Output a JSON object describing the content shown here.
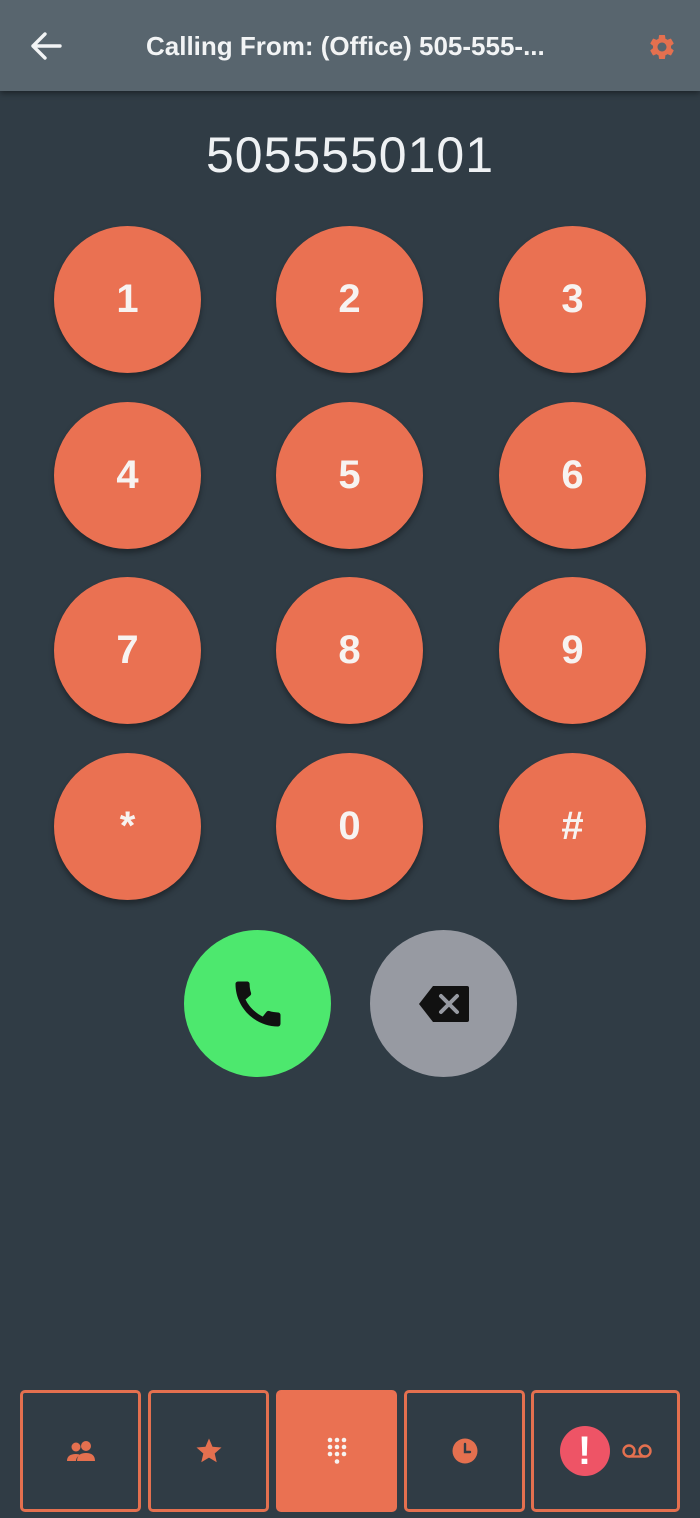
{
  "header": {
    "title": "Calling From: (Office) 505-555-...",
    "back_icon": "arrow-left-icon",
    "settings_icon": "gear-icon"
  },
  "dialed_number": "5055550101",
  "keypad": {
    "keys": [
      "1",
      "2",
      "3",
      "4",
      "5",
      "6",
      "7",
      "8",
      "9",
      "*",
      "0",
      "#"
    ]
  },
  "actions": {
    "call_icon": "phone-icon",
    "backspace_icon": "backspace-icon"
  },
  "tabs": [
    {
      "name": "contacts",
      "icon": "contacts-icon"
    },
    {
      "name": "favorites",
      "icon": "star-icon"
    },
    {
      "name": "keypad",
      "icon": "dialpad-icon",
      "active": true
    },
    {
      "name": "recents",
      "icon": "clock-icon"
    },
    {
      "name": "voicemail",
      "icon": "voicemail-icon",
      "badge": "!"
    }
  ],
  "colors": {
    "background": "#303c45",
    "header": "#58656e",
    "accent": "#ea7152",
    "call": "#4de86e",
    "backspace": "#979aa2",
    "badge": "#ee5466"
  }
}
